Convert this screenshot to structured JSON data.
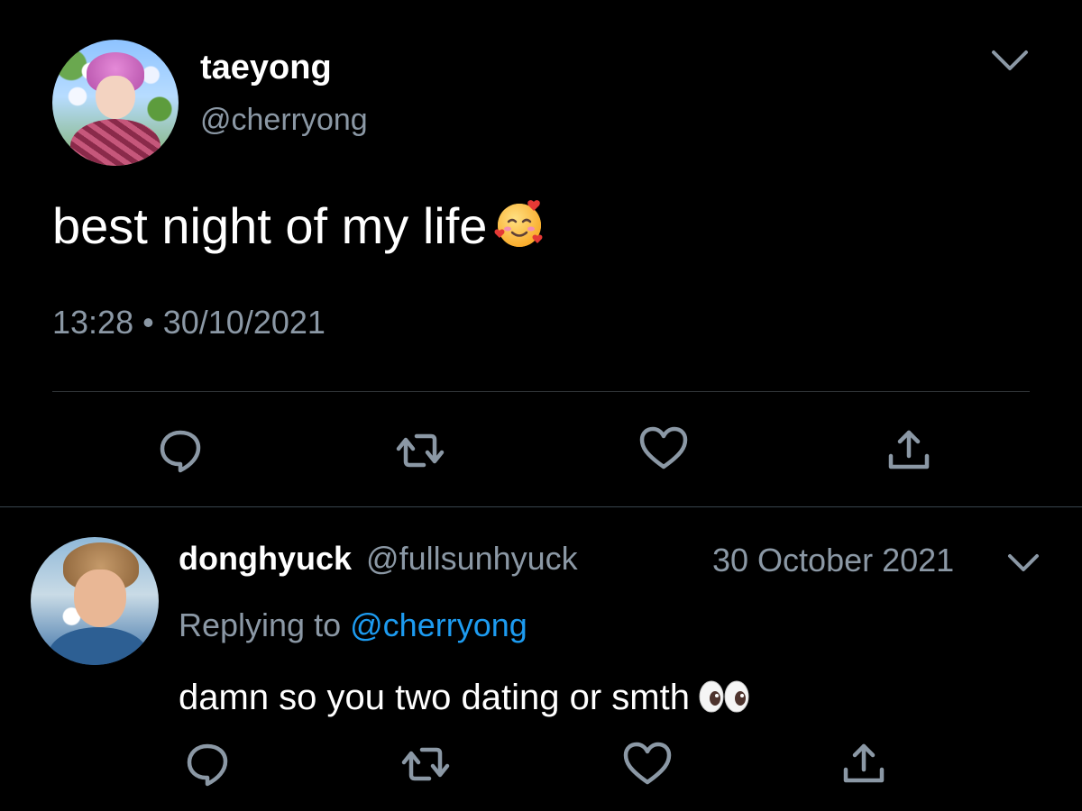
{
  "main_tweet": {
    "display_name": "taeyong",
    "handle": "@cherryong",
    "text": "best night of my life",
    "emoji": "smiling-face-with-hearts-icon",
    "time": "13:28",
    "separator": "•",
    "date": "30/10/2021",
    "actions": [
      "reply-icon",
      "retweet-icon",
      "like-icon",
      "share-icon"
    ]
  },
  "reply_tweet": {
    "display_name": "donghyuck",
    "handle": "@fullsunhyuck",
    "date": "30 October 2021",
    "replying_label": "Replying to",
    "replying_to": "@cherryong",
    "text": "damn so you two dating or smth",
    "emoji": "eyes-icon",
    "actions": [
      "reply-icon",
      "retweet-icon",
      "like-icon",
      "share-icon"
    ]
  },
  "colors": {
    "background": "#000000",
    "text_primary": "#ffffff",
    "text_secondary": "#8b98a5",
    "link": "#1d9bf0",
    "divider": "#2f3336",
    "icon": "#8b98a5"
  }
}
